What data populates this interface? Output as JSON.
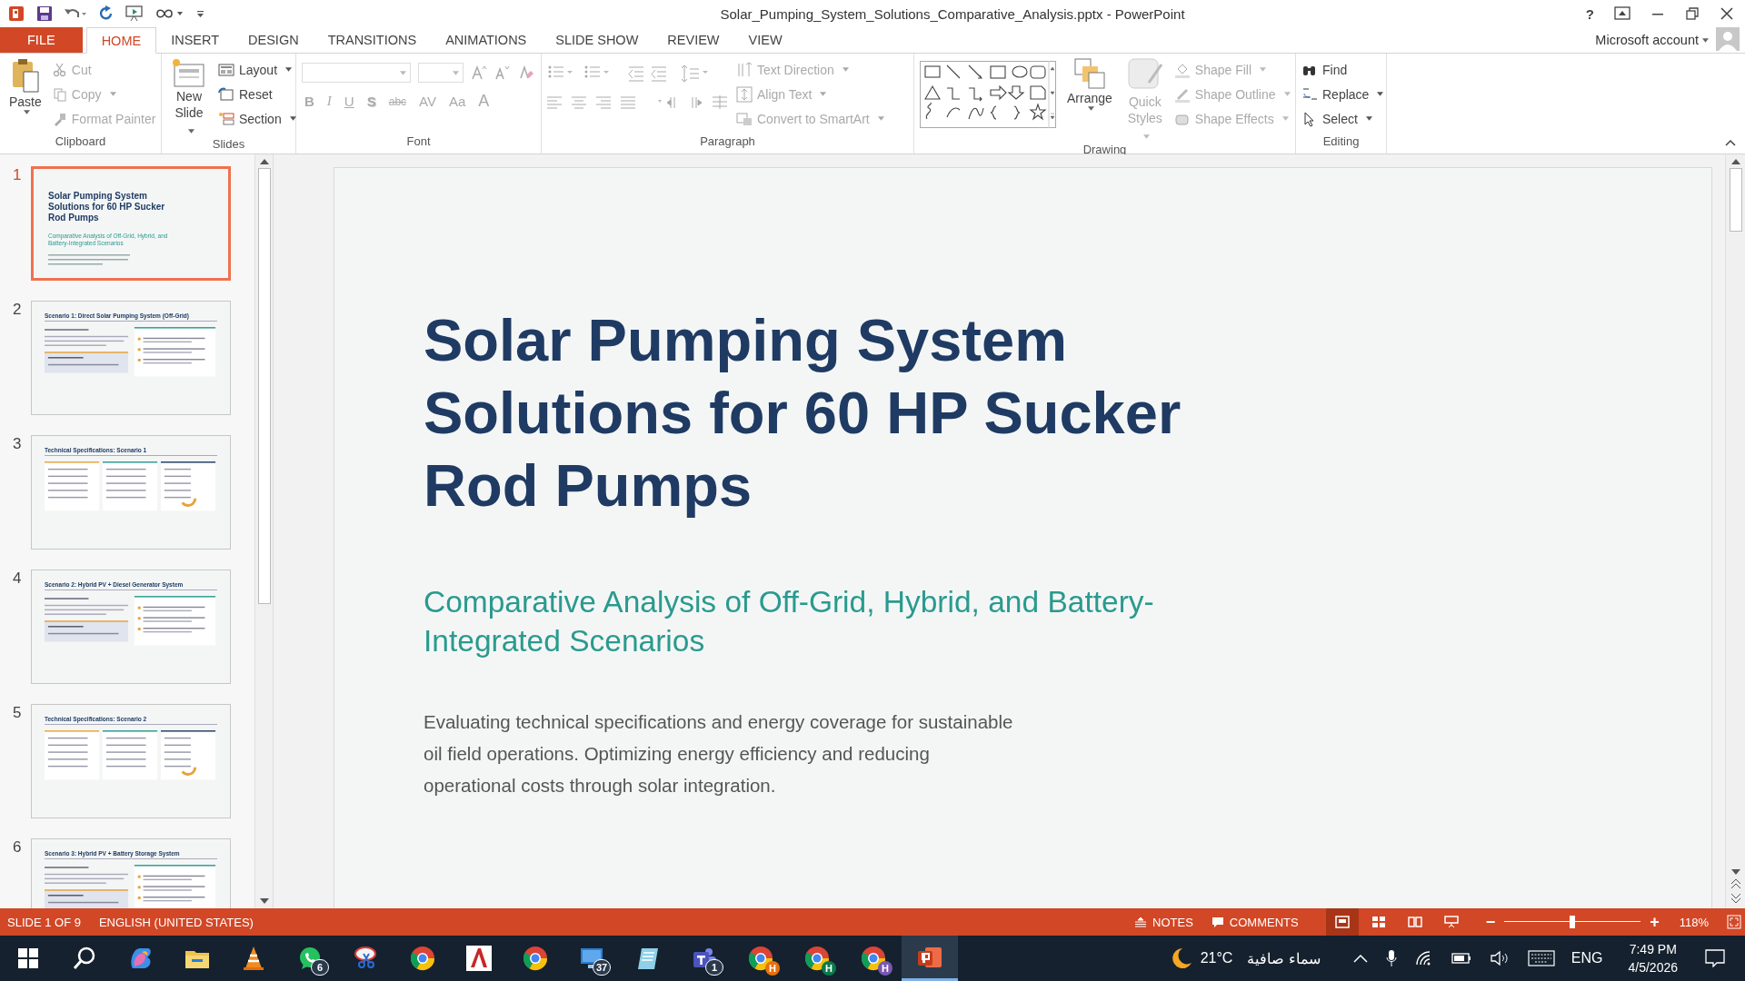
{
  "window": {
    "title": "Solar_Pumping_System_Solutions_Comparative_Analysis.pptx - PowerPoint",
    "help": "?"
  },
  "ribbon_tabs": [
    {
      "label": "FILE",
      "kind": "file",
      "selected": false
    },
    {
      "label": "HOME",
      "kind": "tab",
      "selected": true
    },
    {
      "label": "INSERT",
      "kind": "tab",
      "selected": false
    },
    {
      "label": "DESIGN",
      "kind": "tab",
      "selected": false
    },
    {
      "label": "TRANSITIONS",
      "kind": "tab",
      "selected": false
    },
    {
      "label": "ANIMATIONS",
      "kind": "tab",
      "selected": false
    },
    {
      "label": "SLIDE SHOW",
      "kind": "tab",
      "selected": false
    },
    {
      "label": "REVIEW",
      "kind": "tab",
      "selected": false
    },
    {
      "label": "VIEW",
      "kind": "tab",
      "selected": false
    }
  ],
  "account": "Microsoft account",
  "ribbon": {
    "clipboard": {
      "label": "Clipboard",
      "paste": "Paste",
      "items": [
        {
          "label": "Cut",
          "disabled": true,
          "dropdown": false
        },
        {
          "label": "Copy",
          "disabled": true,
          "dropdown": true
        },
        {
          "label": "Format Painter",
          "disabled": true,
          "dropdown": false
        }
      ]
    },
    "slides": {
      "label": "Slides",
      "new_slide": [
        "New",
        "Slide"
      ],
      "items": [
        {
          "label": "Layout",
          "dropdown": true
        },
        {
          "label": "Reset",
          "dropdown": false
        },
        {
          "label": "Section",
          "dropdown": true
        }
      ]
    },
    "font": {
      "label": "Font",
      "disabled": true,
      "buttons": [
        "B",
        "I",
        "U",
        "S",
        "abc",
        "AV",
        "Aa",
        "A"
      ]
    },
    "paragraph": {
      "label": "Paragraph",
      "disabled": true,
      "items": [
        "Text Direction",
        "Align Text",
        "Convert to SmartArt"
      ]
    },
    "drawing": {
      "label": "Drawing",
      "arrange": "Arrange",
      "quick_styles": {
        "lines": [
          "Quick",
          "Styles"
        ],
        "disabled": true
      },
      "items": [
        {
          "label": "Shape Fill",
          "disabled": true
        },
        {
          "label": "Shape Outline",
          "disabled": true
        },
        {
          "label": "Shape Effects",
          "disabled": true
        }
      ]
    },
    "editing": {
      "label": "Editing",
      "items": [
        {
          "label": "Find",
          "dropdown": false
        },
        {
          "label": "Replace",
          "dropdown": true
        },
        {
          "label": "Select",
          "dropdown": true
        }
      ]
    }
  },
  "thumbnails": [
    {
      "number": "1",
      "selected": true,
      "kind": "title",
      "title": "Solar Pumping System Solutions for 60 HP Sucker Rod Pumps",
      "subtitle": "Comparative Analysis of Off-Grid, Hybrid, and Battery-Integrated Scenarios"
    },
    {
      "number": "2",
      "selected": false,
      "kind": "concept",
      "title": "Scenario 1: Direct Solar Pumping System (Off-Grid)"
    },
    {
      "number": "3",
      "selected": false,
      "kind": "specs",
      "title": "Technical Specifications: Scenario 1"
    },
    {
      "number": "4",
      "selected": false,
      "kind": "concept",
      "title": "Scenario 2: Hybrid PV + Diesel Generator System"
    },
    {
      "number": "5",
      "selected": false,
      "kind": "specs",
      "title": "Technical Specifications: Scenario 2"
    },
    {
      "number": "6",
      "selected": false,
      "kind": "concept",
      "title": "Scenario 3: Hybrid PV + Battery Storage System"
    }
  ],
  "slide": {
    "title": "Solar Pumping System Solutions for 60 HP Sucker Rod Pumps",
    "subtitle": "Comparative Analysis of Off-Grid, Hybrid, and Battery-Integrated Scenarios",
    "body": "Evaluating technical specifications and energy coverage for sustainable oil field operations. Optimizing energy efficiency and reducing operational costs through solar integration."
  },
  "status_bar": {
    "slide_indicator": "SLIDE 1 OF 9",
    "language": "ENGLISH (UNITED STATES)",
    "notes": "NOTES",
    "comments": "COMMENTS",
    "views": [
      {
        "kind": "normal",
        "selected": true
      },
      {
        "kind": "sorter",
        "selected": false
      },
      {
        "kind": "reading",
        "selected": false
      },
      {
        "kind": "slideshow",
        "selected": false
      }
    ],
    "zoom": {
      "minus": "−",
      "plus": "+",
      "level": 0.5,
      "reading": "118%"
    }
  },
  "taskbar": {
    "apps": [
      {
        "kind": "search",
        "active": false
      },
      {
        "kind": "copilot",
        "active": false
      },
      {
        "kind": "folder",
        "active": false
      },
      {
        "kind": "cone",
        "active": false
      },
      {
        "kind": "chat",
        "badge": "6",
        "active": false
      },
      {
        "kind": "scissors",
        "active": false
      },
      {
        "kind": "browser",
        "active": false
      },
      {
        "kind": "cad",
        "active": false
      },
      {
        "kind": "browser",
        "active": false
      },
      {
        "kind": "monitor",
        "badge": "37",
        "active": false
      },
      {
        "kind": "notepad",
        "active": false
      },
      {
        "kind": "teams",
        "badge": "1",
        "active": false
      },
      {
        "kind": "browser",
        "badge": "H",
        "color": "#e8710a",
        "active": false
      },
      {
        "kind": "browser",
        "badge": "H",
        "color": "#0b7a4b",
        "active": false
      },
      {
        "kind": "browser",
        "badge": "H",
        "color": "#7a57b0",
        "active": false
      },
      {
        "kind": "slides",
        "active": true
      }
    ],
    "weather_temp": "21°C",
    "weather_text": "سماء صافية",
    "language": "ENG",
    "time": "7:49 PM",
    "date": "4/5/2026"
  }
}
